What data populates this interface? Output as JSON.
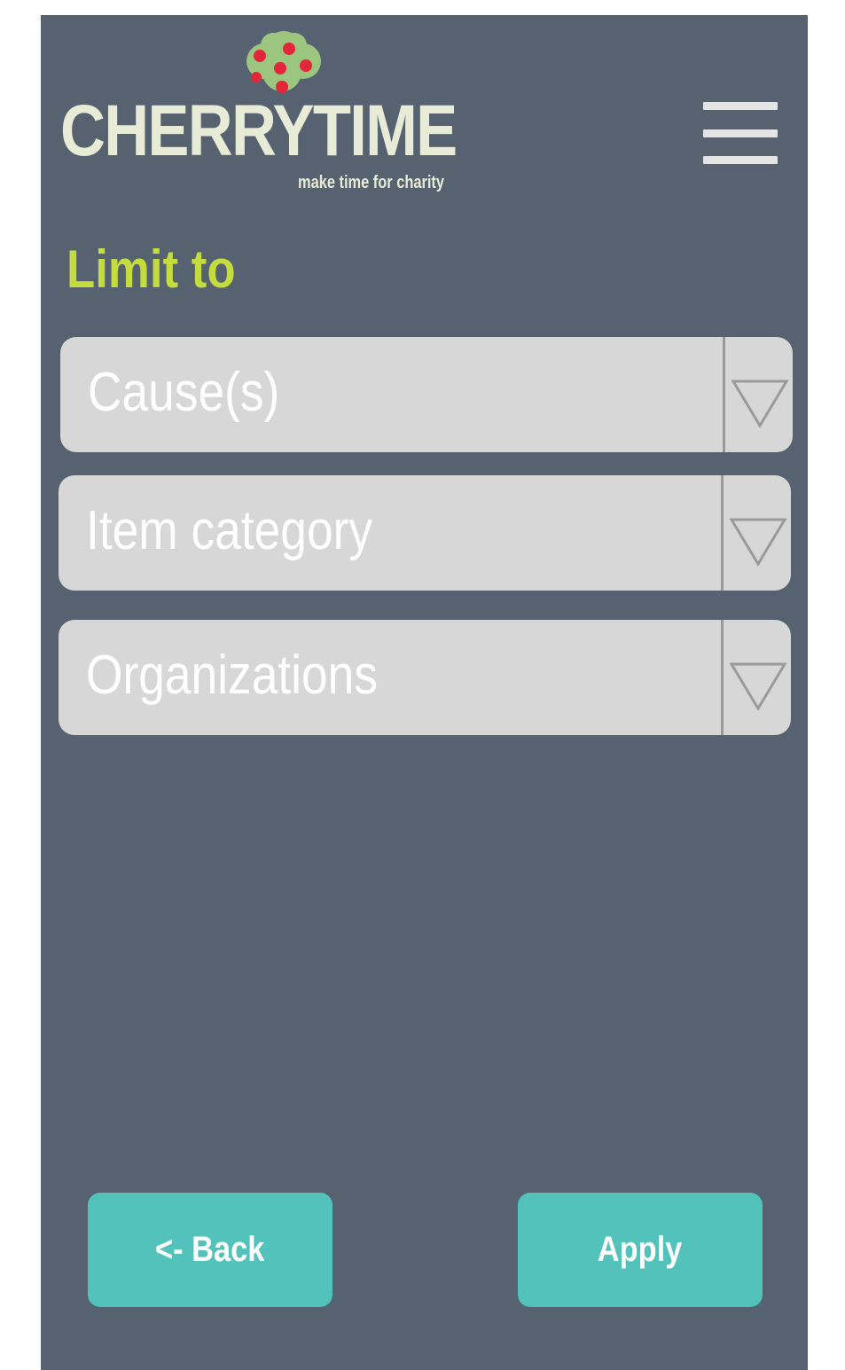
{
  "header": {
    "logo_text": "CHERRYTIME",
    "logo_tagline": "make time for charity",
    "menu_icon": "hamburger-icon"
  },
  "filters": {
    "title": "Limit to",
    "dropdowns": [
      {
        "label": "Cause(s)",
        "icon": "triangle-down-icon"
      },
      {
        "label": "Item category",
        "icon": "triangle-down-icon"
      },
      {
        "label": "Organizations",
        "icon": "triangle-down-icon"
      }
    ]
  },
  "actions": {
    "back_label": "<- Back",
    "apply_label": "Apply"
  },
  "colors": {
    "background": "#566270",
    "title_accent": "#c5dc3f",
    "dropdown_fill": "#d7d7d7",
    "button_fill": "#52c2bb",
    "logo_text": "#e8ebd5",
    "cherry_red": "#e3263a",
    "tree_green": "#9cc57f"
  }
}
